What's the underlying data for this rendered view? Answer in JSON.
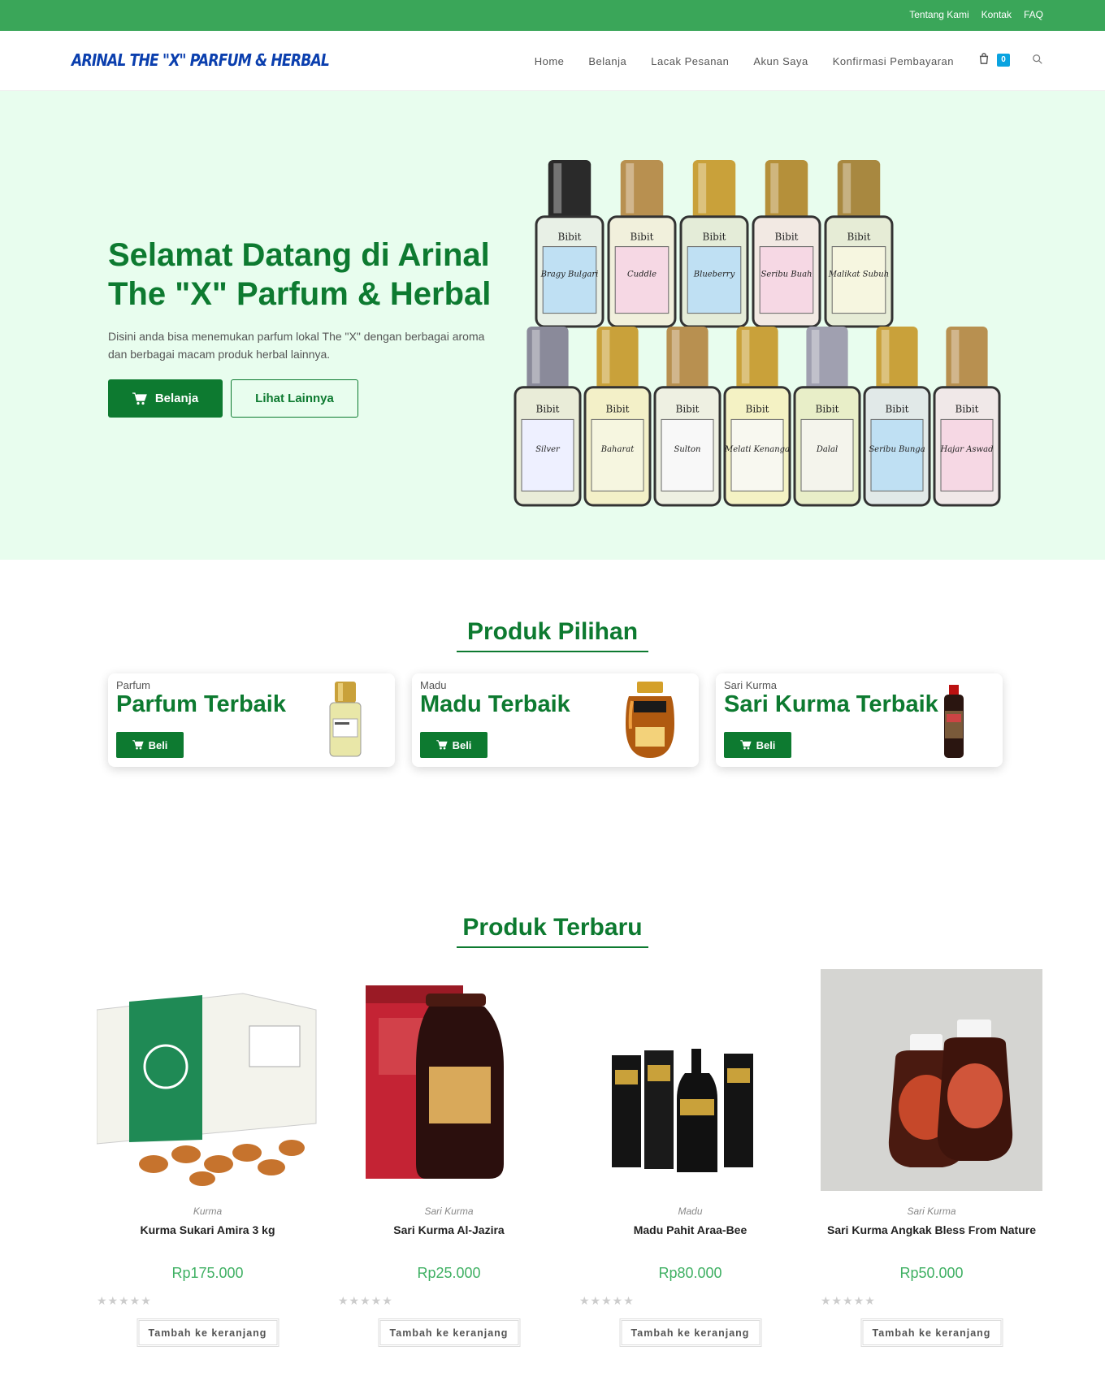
{
  "topbar": {
    "links": [
      "Tentang Kami",
      "Kontak",
      "FAQ"
    ]
  },
  "header": {
    "logo": "ARINAL THE \"X\" PARFUM & HERBAL",
    "nav": [
      "Home",
      "Belanja",
      "Lacak Pesanan",
      "Akun Saya",
      "Konfirmasi Pembayaran"
    ],
    "cart_count": "0"
  },
  "hero": {
    "title": "Selamat Datang di Arinal The \"X\" Parfum & Herbal",
    "subtitle": "Disini anda bisa menemukan parfum lokal The \"X\" dengan berbagai aroma dan berbagai macam produk herbal lainnya.",
    "primary_button": "Belanja",
    "secondary_button": "Lihat Lainnya",
    "bottle_labels_top": [
      "Bragy Bulgari",
      "Cuddle",
      "Blueberry",
      "Seribu Buah",
      "Malikat Subuh"
    ],
    "bottle_labels_bottom": [
      "Silver",
      "Baharat",
      "Sulton",
      "Melati Kenanga",
      "Dalal",
      "Seribu Bunga",
      "Hajar Aswad"
    ],
    "bottle_word": "Bibit"
  },
  "featured": {
    "title": "Produk Pilihan",
    "items": [
      {
        "category": "Parfum",
        "title": "Parfum Terbaik",
        "button": "Beli"
      },
      {
        "category": "Madu",
        "title": "Madu Terbaik",
        "button": "Beli"
      },
      {
        "category": "Sari Kurma",
        "title": "Sari Kurma Terbaik",
        "button": "Beli"
      }
    ]
  },
  "latest": {
    "title": "Produk Terbaru",
    "items": [
      {
        "category": "Kurma",
        "name": "Kurma Sukari Amira 3 kg",
        "price": "Rp175.000",
        "button": "Tambah ke keranjang",
        "rating": 0
      },
      {
        "category": "Sari Kurma",
        "name": "Sari Kurma Al-Jazira",
        "price": "Rp25.000",
        "button": "Tambah ke keranjang",
        "rating": 0
      },
      {
        "category": "Madu",
        "name": "Madu Pahit Araa-Bee",
        "price": "Rp80.000",
        "button": "Tambah ke keranjang",
        "rating": 0
      },
      {
        "category": "Sari Kurma",
        "name": "Sari Kurma Angkak Bless From Nature",
        "price": "Rp50.000",
        "button": "Tambah ke keranjang",
        "rating": 0
      }
    ]
  },
  "colors": {
    "topbar": "#3aa659",
    "brand_green": "#0d7a30",
    "hero_bg": "#e8fdee",
    "logo": "#0b3fae",
    "price": "#3fb063"
  }
}
